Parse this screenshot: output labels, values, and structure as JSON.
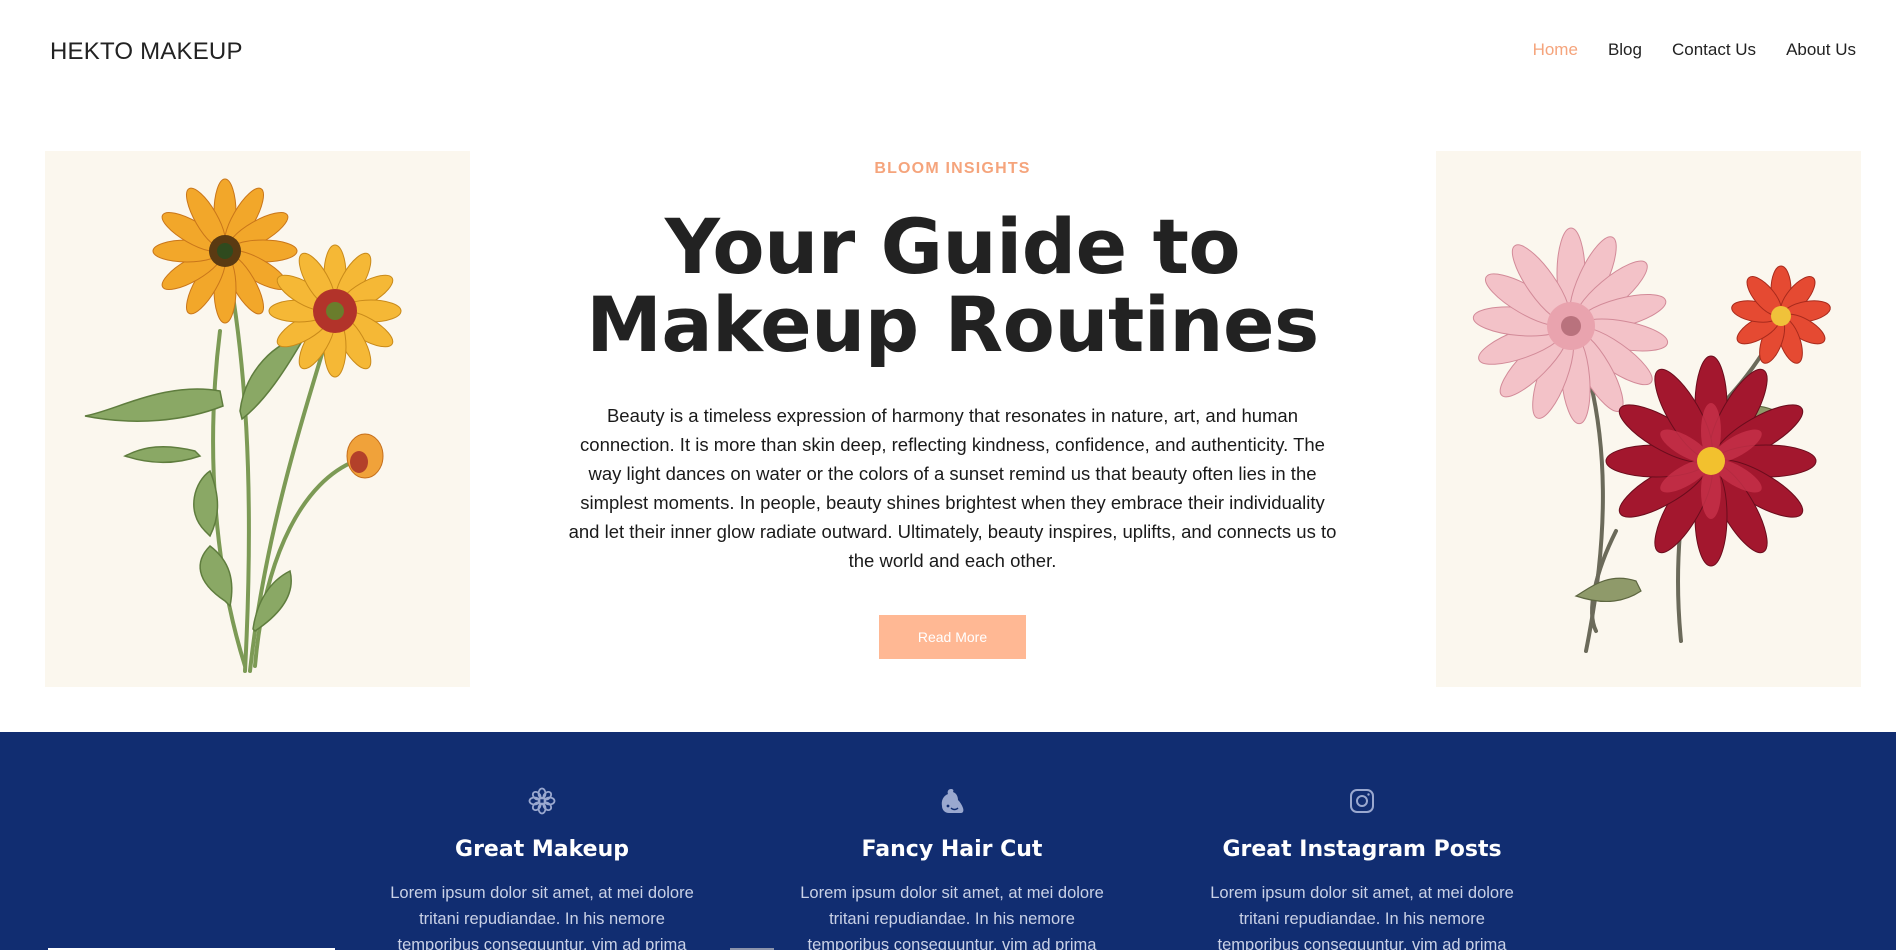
{
  "header": {
    "logo": "HEKTO MAKEUP",
    "nav": [
      {
        "label": "Home",
        "active": true
      },
      {
        "label": "Blog",
        "active": false
      },
      {
        "label": "Contact Us",
        "active": false
      },
      {
        "label": "About Us",
        "active": false
      }
    ]
  },
  "hero": {
    "eyebrow": "BLOOM INSIGHTS",
    "title_line1": "Your Guide to",
    "title_line2": "Makeup Routines",
    "text": "Beauty is a timeless expression of harmony that resonates in nature, art, and human connection. It is more than skin deep, reflecting kindness, confidence, and authenticity. The way light dances on water or the colors of a sunset remind us that beauty often lies in the simplest moments. In people, beauty shines brightest when they embrace their individuality and let their inner glow radiate outward. Ultimately, beauty inspires, uplifts, and connects us to the world and each other.",
    "button": "Read More",
    "left_image": "yellow-flowers-illustration",
    "right_image": "pink-red-dahlias-illustration"
  },
  "features": [
    {
      "icon": "flower-icon",
      "title": "Great Makeup",
      "text": "Lorem ipsum dolor sit amet, at mei dolore tritani repudiandae. In his nemore temporibus consequuntur, vim ad prima"
    },
    {
      "icon": "hair-icon",
      "title": "Fancy Hair Cut",
      "text": "Lorem ipsum dolor sit amet, at mei dolore tritani repudiandae. In his nemore temporibus consequuntur, vim ad prima"
    },
    {
      "icon": "instagram-icon",
      "title": "Great Instagram Posts",
      "text": "Lorem ipsum dolor sit amet, at mei dolore tritani repudiandae. In his nemore temporibus consequuntur, vim ad prima"
    }
  ],
  "colors": {
    "accent": "#f5a47c",
    "button": "#ffb894",
    "band": "#112d71",
    "image_bg": "#fbf7ee",
    "icon": "#9aa8cf"
  }
}
